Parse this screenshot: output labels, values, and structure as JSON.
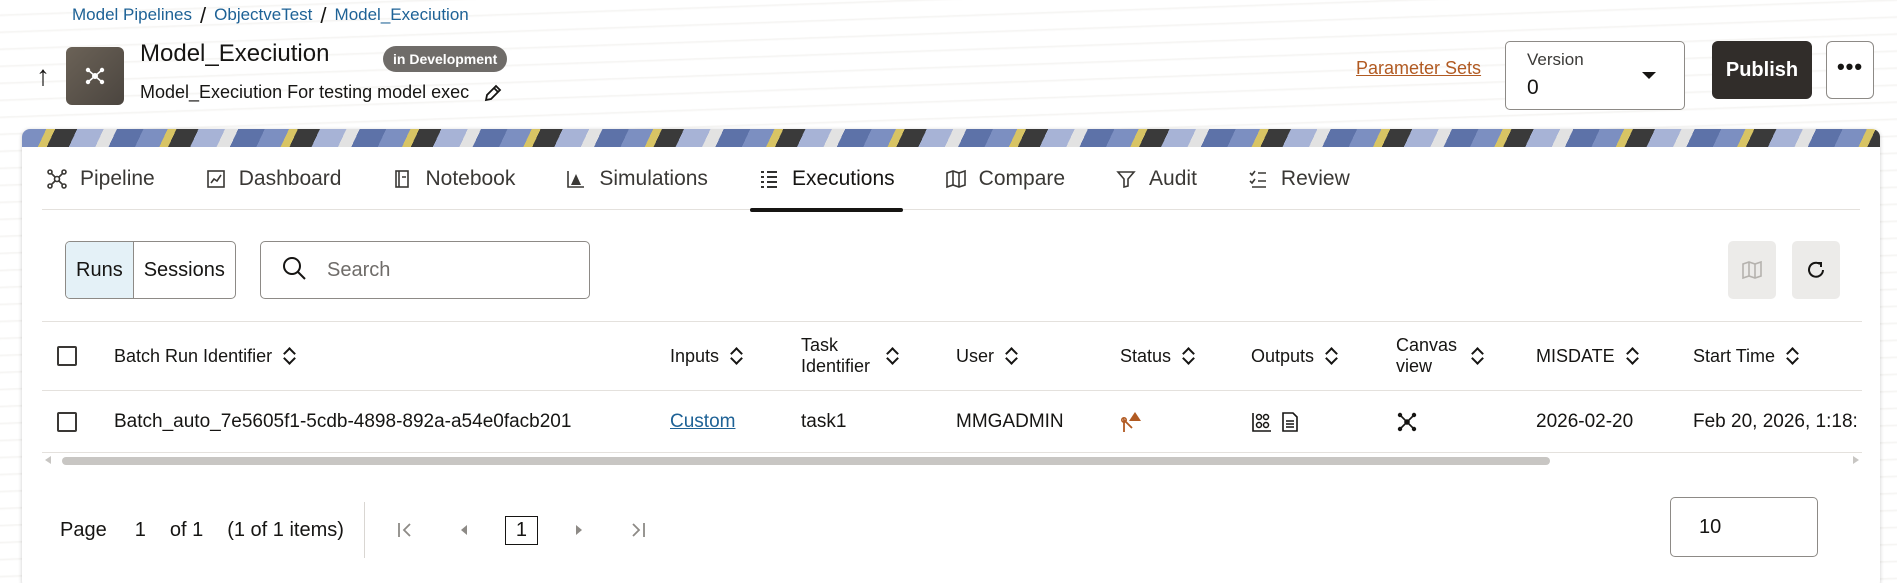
{
  "breadcrumb": [
    "Model Pipelines",
    "ObjectveTest",
    "Model_Execiution"
  ],
  "header": {
    "title": "Model_Execiution",
    "badge": "in Development",
    "subtitle": "Model_Execiution For testing model exec",
    "parameter_sets": "Parameter Sets",
    "version_label": "Version",
    "version_value": "0",
    "publish_label": "Publish",
    "more_label": "•••"
  },
  "tabs": [
    {
      "label": "Pipeline",
      "icon": "pipeline-icon"
    },
    {
      "label": "Dashboard",
      "icon": "dashboard-icon"
    },
    {
      "label": "Notebook",
      "icon": "notebook-icon"
    },
    {
      "label": "Simulations",
      "icon": "simulations-icon"
    },
    {
      "label": "Executions",
      "icon": "executions-icon",
      "active": true
    },
    {
      "label": "Compare",
      "icon": "compare-icon"
    },
    {
      "label": "Audit",
      "icon": "audit-icon"
    },
    {
      "label": "Review",
      "icon": "review-icon"
    }
  ],
  "toolbar": {
    "runs": "Runs",
    "sessions": "Sessions",
    "search_placeholder": "Search"
  },
  "table": {
    "columns": [
      "Batch Run Identifier",
      "Inputs",
      "Task Identifier",
      "User",
      "Status",
      "Outputs",
      "Canvas view",
      "MISDATE",
      "Start Time"
    ],
    "rows": [
      {
        "batch_run_identifier": "Batch_auto_7e5605f1-5cdb-4898-892a-a54e0facb201",
        "inputs": "Custom",
        "task_identifier": "task1",
        "user": "MMGADMIN",
        "status_icon": "warning-status-icon",
        "outputs_icons": [
          "chart-output-icon",
          "document-output-icon"
        ],
        "canvas_icon": "canvas-icon",
        "misdate": "2026-02-20",
        "start_time": "Feb 20, 2026, 1:18:"
      }
    ]
  },
  "pagination": {
    "page_label": "Page",
    "page_value": "1",
    "of_label": "of 1",
    "items_label": "(1 of 1 items)",
    "current": "1",
    "page_size": "10"
  },
  "colors": {
    "publish_bg": "#312d2a",
    "link": "#1e6296",
    "parameter_link": "#b15a22",
    "badge_bg": "#6f6c69",
    "active_segment": "#e4f1f7"
  }
}
